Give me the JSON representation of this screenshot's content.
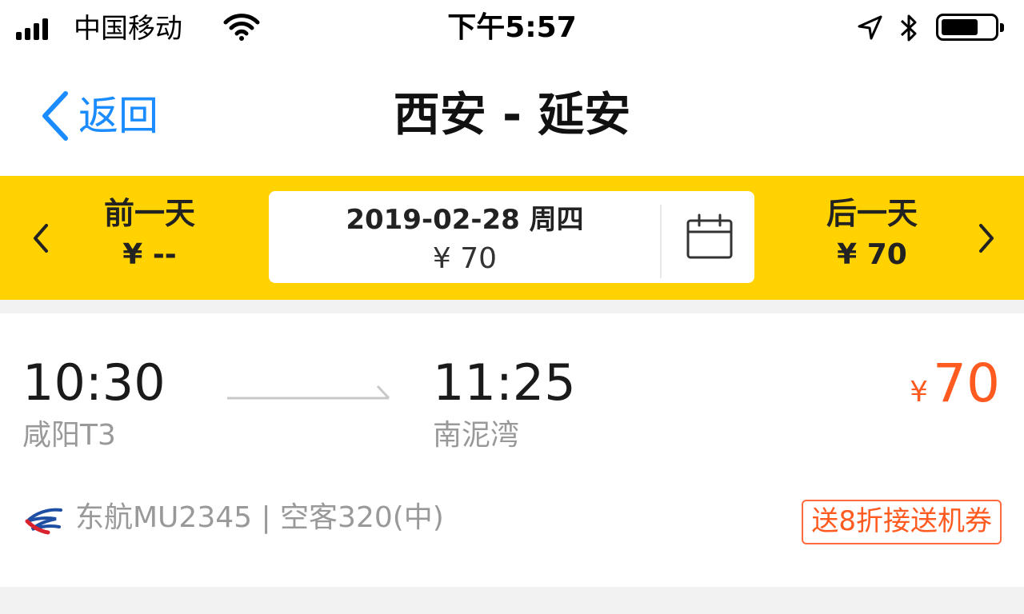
{
  "status_bar": {
    "carrier": "中国移动",
    "time": "下午5:57",
    "battery_level": 0.7
  },
  "nav": {
    "back_label": "返回",
    "title": "西安 - 延安"
  },
  "date_bar": {
    "prev_day_label": "前一天",
    "prev_day_price": "¥ --",
    "current_date": "2019-02-28 周四",
    "current_price": "¥ 70",
    "next_day_label": "后一天",
    "next_day_price": "¥ 70"
  },
  "flight": {
    "departure_time": "10:30",
    "departure_airport": "咸阳T3",
    "arrival_time": "11:25",
    "arrival_airport": "南泥湾",
    "price_currency": "¥",
    "price": "70",
    "flight_info": "东航MU2345 | 空客320(中)",
    "promo": "送8折接送机券"
  },
  "colors": {
    "accent_yellow": "#ffd200",
    "link_blue": "#1a8cff",
    "price_orange": "#ff5a1f"
  }
}
